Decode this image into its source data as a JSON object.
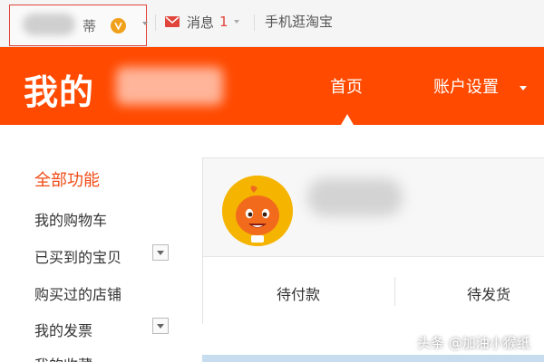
{
  "topbar": {
    "username_suffix": "蒂",
    "messages_label": "消息",
    "messages_count": "1",
    "mobile_link": "手机逛淘宝",
    "accent_color": "#e0443a"
  },
  "header": {
    "brand": "我的",
    "nav_home": "首页",
    "nav_account": "账户设置",
    "background_color": "#ff4a00"
  },
  "sidebar": {
    "items": [
      {
        "label": "全部功能",
        "active": true,
        "expandable": false
      },
      {
        "label": "我的购物车",
        "active": false,
        "expandable": false
      },
      {
        "label": "已买到的宝贝",
        "active": false,
        "expandable": true
      },
      {
        "label": "购买过的店铺",
        "active": false,
        "expandable": false
      },
      {
        "label": "我的发票",
        "active": false,
        "expandable": true
      },
      {
        "label": "我的收藏",
        "active": false,
        "expandable": false
      }
    ]
  },
  "orders": {
    "pending_payment": "待付款",
    "pending_shipment": "待发货"
  },
  "watermark": "头条 @加油小猴纸",
  "icons": [
    "vip-badge-icon",
    "mail-icon",
    "chevron-down-icon",
    "mascot-avatar"
  ]
}
